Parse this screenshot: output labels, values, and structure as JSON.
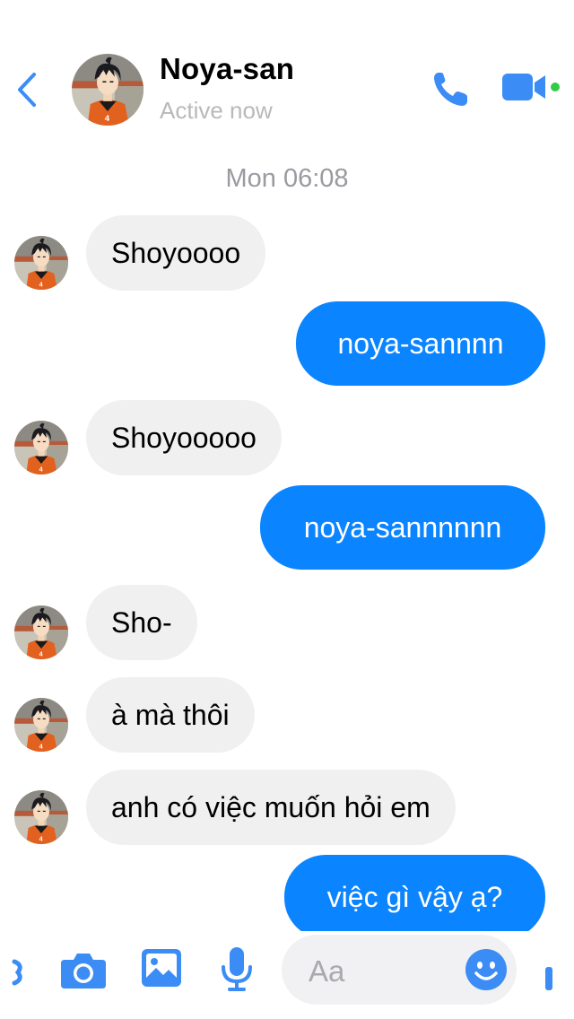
{
  "header": {
    "contact_name": "Noya-san",
    "status": "Active now"
  },
  "timestamp": "Mon 06:08",
  "messages": [
    {
      "direction": "incoming",
      "text": "Shoyoooo"
    },
    {
      "direction": "outgoing",
      "text": "noya-sannnn"
    },
    {
      "direction": "incoming",
      "text": "Shoyooooo"
    },
    {
      "direction": "outgoing",
      "text": "noya-sannnnnn"
    },
    {
      "direction": "incoming",
      "text": "Sho-"
    },
    {
      "direction": "incoming",
      "text": "à mà thôi"
    },
    {
      "direction": "incoming",
      "text": "anh có việc muốn hỏi em"
    },
    {
      "direction": "outgoing",
      "text": "việc gì vậy ạ?"
    }
  ],
  "composer": {
    "placeholder": "Aa"
  },
  "colors": {
    "accent": "#0b84ff",
    "icon_blue": "#3b8df5",
    "incoming_bubble": "#f0f0f0",
    "online_dot": "#31cc46",
    "muted_text": "#9a9aa0"
  },
  "icons": [
    "back-chevron-icon",
    "phone-icon",
    "video-camera-icon",
    "camera-icon",
    "image-icon",
    "microphone-icon",
    "emoji-icon"
  ]
}
